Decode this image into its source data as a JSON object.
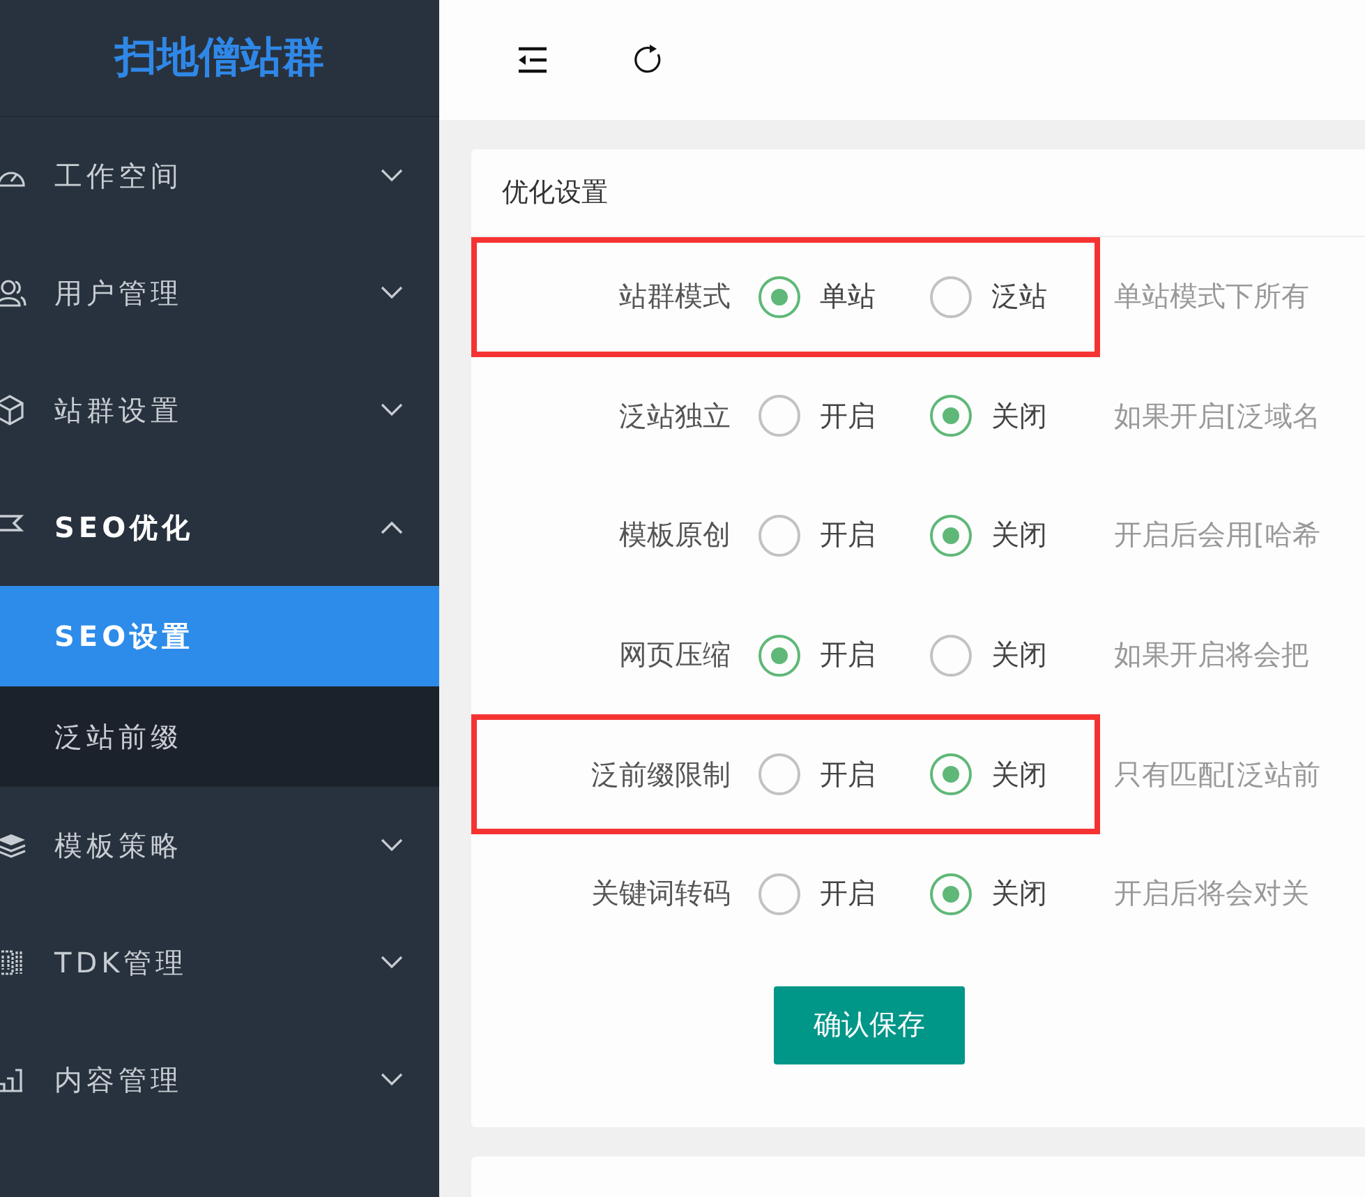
{
  "sidebar": {
    "logo": "扫地僧站群",
    "items": [
      {
        "label": "工作空间",
        "expanded": false
      },
      {
        "label": "用户管理",
        "expanded": false
      },
      {
        "label": "站群设置",
        "expanded": false
      },
      {
        "label": "SEO优化",
        "expanded": true,
        "children": [
          {
            "label": "SEO设置",
            "selected": true
          },
          {
            "label": "泛站前缀",
            "selected": false
          }
        ]
      },
      {
        "label": "模板策略",
        "expanded": false
      },
      {
        "label": "TDK管理",
        "expanded": false
      },
      {
        "label": "内容管理",
        "expanded": false
      }
    ]
  },
  "card": {
    "title": "优化设置",
    "rows": [
      {
        "label": "站群模式",
        "highlighted": true,
        "options": [
          {
            "label": "单站",
            "selected": true
          },
          {
            "label": "泛站",
            "selected": false
          }
        ],
        "description": "单站模式下所有"
      },
      {
        "label": "泛站独立",
        "highlighted": false,
        "options": [
          {
            "label": "开启",
            "selected": false
          },
          {
            "label": "关闭",
            "selected": true
          }
        ],
        "description": "如果开启[泛域名"
      },
      {
        "label": "模板原创",
        "highlighted": false,
        "options": [
          {
            "label": "开启",
            "selected": false
          },
          {
            "label": "关闭",
            "selected": true
          }
        ],
        "description": "开启后会用[哈希"
      },
      {
        "label": "网页压缩",
        "highlighted": false,
        "options": [
          {
            "label": "开启",
            "selected": true
          },
          {
            "label": "关闭",
            "selected": false
          }
        ],
        "description": "如果开启将会把"
      },
      {
        "label": "泛前缀限制",
        "highlighted": true,
        "options": [
          {
            "label": "开启",
            "selected": false
          },
          {
            "label": "关闭",
            "selected": true
          }
        ],
        "description": "只有匹配[泛站前"
      },
      {
        "label": "关键词转码",
        "highlighted": false,
        "options": [
          {
            "label": "开启",
            "selected": false
          },
          {
            "label": "关闭",
            "selected": true
          }
        ],
        "description": "开启后将会对关"
      }
    ],
    "save_button": "确认保存"
  }
}
